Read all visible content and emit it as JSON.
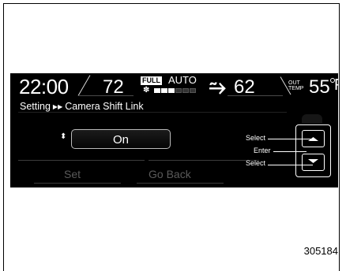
{
  "status_bar": {
    "time": "22:00",
    "left_temp": "72",
    "fan_mode_badge": "FULL",
    "climate_mode": "AUTO",
    "fan_level": 0.45,
    "right_temp": "62",
    "outside_label_line1": "OUT",
    "outside_label_line2": "TEMP",
    "outside_temp": "55",
    "outside_temp_unit": "F"
  },
  "breadcrumb": {
    "parent": "Setting",
    "separator": "▶▶",
    "current": "Camera Shift Link"
  },
  "setting": {
    "value": "On"
  },
  "buttons": {
    "set": "Set",
    "go_back": "Go Back"
  },
  "control_labels": {
    "select_up": "Select",
    "enter": "Enter",
    "select_down": "Select"
  },
  "figure_number": "305184",
  "icons": {
    "fan": "fan-icon",
    "vent": "vent-airflow-icon",
    "up_down": "up-down-arrow-icon",
    "arrow_up": "arrow-up-icon",
    "arrow_down": "arrow-down-icon"
  },
  "colors": {
    "screen_background": "#000000",
    "text": "#ffffff",
    "inactive_text": "#5a5a5a"
  }
}
